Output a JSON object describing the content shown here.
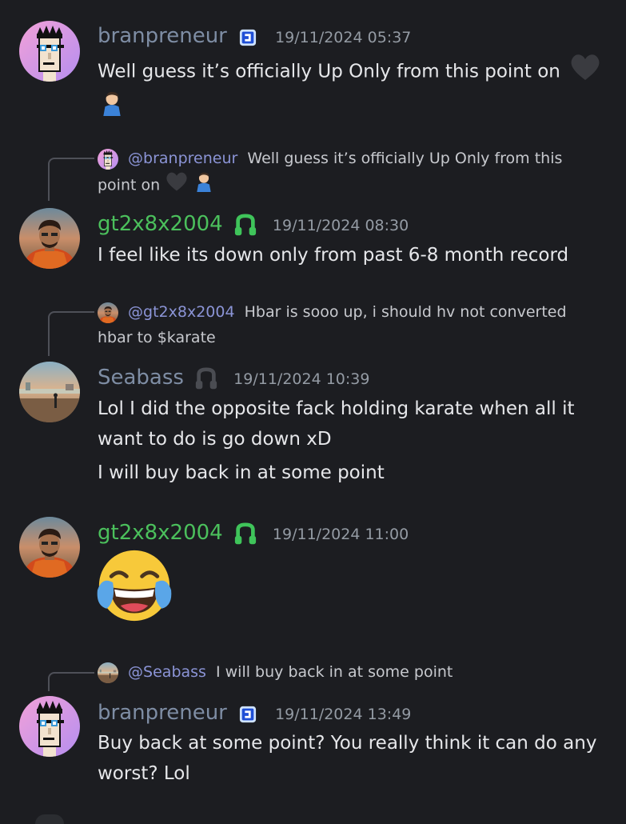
{
  "colors": {
    "background": "#1c1d21",
    "branpreneur": "#7e8da4",
    "gt2x8x2004": "#4bc05c",
    "seabass": "#7e8da4",
    "timestamp": "#949ba4",
    "mention": "#8b94d6"
  },
  "messages": [
    {
      "author": "branpreneur",
      "badge_icon": "square-badge-icon",
      "timestamp": "19/11/2024 05:37",
      "lines": [
        "Well guess it’s officially Up Only from this point on"
      ],
      "emojis": [
        "black-heart-icon",
        "facepalm-icon"
      ]
    },
    {
      "reply": {
        "mention": "@branpreneur",
        "text_line1": "Well guess it’s officially Up Only from this",
        "text_line2": "point on"
      },
      "author": "gt2x8x2004",
      "badge_icon": "headset-badge-icon",
      "timestamp": "19/11/2024 08:30",
      "lines": [
        "I feel like its down only from past 6-8 month record"
      ]
    },
    {
      "reply": {
        "mention": "@gt2x8x2004",
        "text_line1": "Hbar is sooo up, i should hv not converted",
        "text_line2": "hbar to $karate"
      },
      "author": "Seabass",
      "badge_icon": "headset-badge-icon",
      "timestamp": "19/11/2024 10:39",
      "lines": [
        "Lol I did the opposite fack holding karate when all it",
        "want to do is go down xD",
        "I will buy back in at some point"
      ]
    },
    {
      "author": "gt2x8x2004",
      "badge_icon": "headset-badge-icon",
      "timestamp": "19/11/2024 11:00",
      "emoji": "tears-of-joy-emoji"
    },
    {
      "reply": {
        "mention": "@Seabass",
        "text_line1": "I will buy back in at some point"
      },
      "author": "branpreneur",
      "badge_icon": "square-badge-icon",
      "timestamp": "19/11/2024 13:49",
      "lines": [
        "Buy back at some point? You really think it can do any",
        "worst? Lol"
      ]
    }
  ]
}
